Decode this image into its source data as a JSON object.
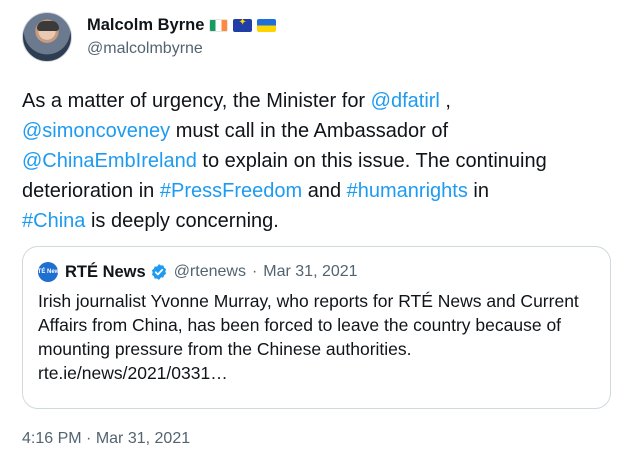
{
  "author": {
    "display_name": "Malcolm Byrne",
    "handle": "@malcolmbyrne",
    "flags": [
      "flag-ireland-icon",
      "flag-eu-icon",
      "flag-ukraine-icon"
    ]
  },
  "tweet": {
    "t1": "As a matter of urgency, the Minister for ",
    "m_dfat": "@dfatirl",
    "t2": " ,",
    "m_simon": "@simoncoveney",
    "t3": " must call in the Ambassador of",
    "m_china_emb": "@ChinaEmbIreland",
    "t4": " to explain on this issue. The continuing deterioration in ",
    "h_press": "#PressFreedom",
    "t5": " and ",
    "h_rights": "#humanrights",
    "t6": " in",
    "h_china": "#China",
    "t7": " is deeply concerning."
  },
  "quoted": {
    "avatar_text": "RTÉ News",
    "name": "RTÉ News",
    "handle": "@rtenews",
    "separator": "·",
    "date": "Mar 31, 2021",
    "text": "Irish journalist Yvonne Murray, who reports for RTÉ News and Current Affairs from China, has been forced to leave the country because of mounting pressure from the Chinese authorities.",
    "link": "rte.ie/news/2021/0331…"
  },
  "timestamp": {
    "time": "4:16 PM",
    "separator": "·",
    "date": "Mar 31, 2021"
  },
  "colors": {
    "link": "#1d9bf0",
    "secondary_text": "#536471",
    "border": "#cfd9de"
  }
}
